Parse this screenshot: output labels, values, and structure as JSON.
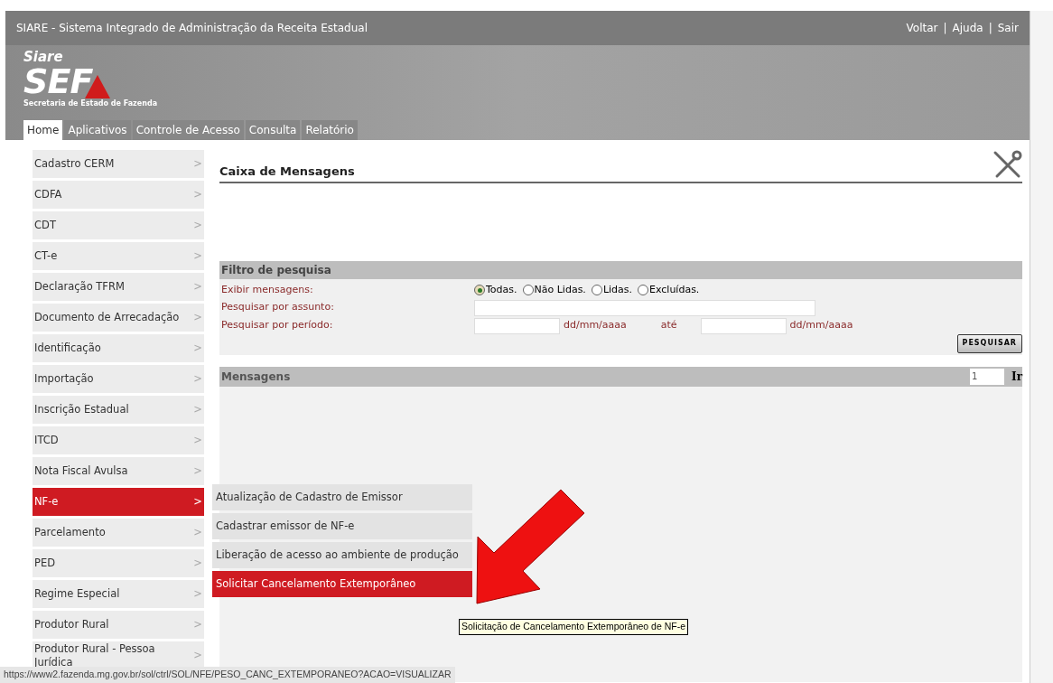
{
  "header": {
    "title": "SIARE - Sistema Integrado de Administração da Receita Estadual",
    "links": [
      "Voltar",
      "Ajuda",
      "Sair"
    ],
    "separator": "|"
  },
  "logo": {
    "top": "Siare",
    "main": "SEF",
    "caption": "Secretaria de Estado de Fazenda"
  },
  "tabs": [
    {
      "label": "Home",
      "selected": true
    },
    {
      "label": "Aplicativos",
      "selected": false
    },
    {
      "label": "Controle de Acesso",
      "selected": false
    },
    {
      "label": "Consulta",
      "selected": false
    },
    {
      "label": "Relatório",
      "selected": false
    }
  ],
  "sidebar": {
    "chevron": ">",
    "items": [
      {
        "label": "Cadastro CERM",
        "selected": false
      },
      {
        "label": "CDFA",
        "selected": false
      },
      {
        "label": "CDT",
        "selected": false
      },
      {
        "label": "CT-e",
        "selected": false
      },
      {
        "label": "Declaração TFRM",
        "selected": false
      },
      {
        "label": "Documento de Arrecadação",
        "selected": false
      },
      {
        "label": "Identificação",
        "selected": false
      },
      {
        "label": "Importação",
        "selected": false
      },
      {
        "label": "Inscrição Estadual",
        "selected": false
      },
      {
        "label": "ITCD",
        "selected": false
      },
      {
        "label": "Nota Fiscal Avulsa",
        "selected": false
      },
      {
        "label": "NF-e",
        "selected": true
      },
      {
        "label": "Parcelamento",
        "selected": false
      },
      {
        "label": "PED",
        "selected": false
      },
      {
        "label": "Regime Especial",
        "selected": false
      },
      {
        "label": "Produtor Rural",
        "selected": false
      },
      {
        "label": "Produtor Rural - Pessoa Jurídica",
        "selected": false
      }
    ]
  },
  "submenu": [
    {
      "label": "Atualização de Cadastro de Emissor",
      "selected": false
    },
    {
      "label": "Cadastrar emissor de NF-e",
      "selected": false
    },
    {
      "label": "Liberação de acesso ao ambiente de produção",
      "selected": false
    },
    {
      "label": "Solicitar Cancelamento Extemporâneo",
      "selected": true
    }
  ],
  "tooltip": "Solicitação de Cancelamento Extemporâneo de NF-e",
  "page_title": "Caixa de Mensagens",
  "filter": {
    "title": "Filtro de pesquisa",
    "show_label": "Exibir mensagens:",
    "options": [
      {
        "label": "Todas.",
        "selected": true
      },
      {
        "label": "Não Lidas.",
        "selected": false
      },
      {
        "label": "Lidas.",
        "selected": false
      },
      {
        "label": "Excluídas.",
        "selected": false
      }
    ],
    "subject_label": "Pesquisar por assunto:",
    "period_label": "Pesquisar por período:",
    "date_hint_from": "dd/mm/aaaa",
    "until": "até",
    "date_hint_to": "dd/mm/aaaa",
    "button": "PESQUISAR"
  },
  "messages": {
    "title": "Mensagens",
    "page": "1",
    "go": "Ir"
  },
  "status_bar": "https://www2.fazenda.mg.gov.br/sol/ctrl/SOL/NFE/PESO_CANC_EXTEMPORANEO?ACAO=VISUALIZAR"
}
